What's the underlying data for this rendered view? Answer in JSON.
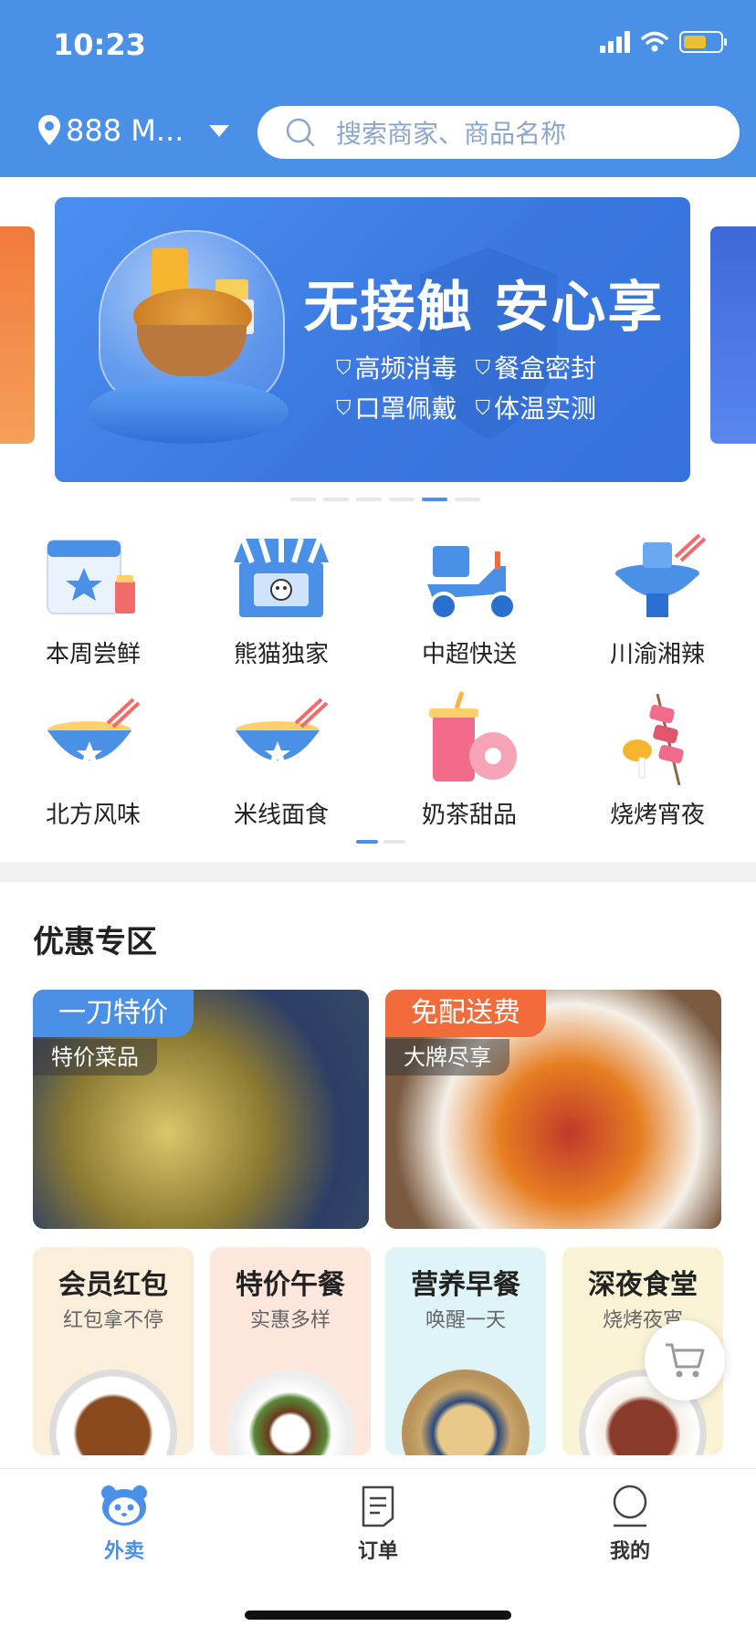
{
  "status": {
    "time": "10:23"
  },
  "header": {
    "location": "888 M...",
    "search_placeholder": "搜索商家、商品名称"
  },
  "banner": {
    "headline": "无接触 安心享",
    "tags": [
      "高频消毒",
      "餐盒密封",
      "口罩佩戴",
      "体温实测"
    ],
    "page_count": 6,
    "active_page": 5
  },
  "categories": [
    {
      "label": "本周尝鲜",
      "icon": "calendar-star-icon"
    },
    {
      "label": "熊猫独家",
      "icon": "panda-shop-icon"
    },
    {
      "label": "中超快送",
      "icon": "scooter-icon"
    },
    {
      "label": "川渝湘辣",
      "icon": "hotpot-icon"
    },
    {
      "label": "北方风味",
      "icon": "noodle-bowl-icon"
    },
    {
      "label": "米线面食",
      "icon": "noodle-bowl-icon"
    },
    {
      "label": "奶茶甜品",
      "icon": "milk-tea-donut-icon"
    },
    {
      "label": "烧烤宵夜",
      "icon": "bbq-skewer-icon"
    }
  ],
  "promo_section": {
    "title": "优惠专区",
    "featured": [
      {
        "tag": "一刀特价",
        "sub": "特价菜品",
        "tag_color": "#4a90e7"
      },
      {
        "tag": "免配送费",
        "sub": "大牌尽享",
        "tag_color": "#f26b3a"
      }
    ],
    "minis": [
      {
        "title": "会员红包",
        "subtitle": "红包拿不停",
        "bg": "#fbefdb"
      },
      {
        "title": "特价午餐",
        "subtitle": "实惠多样",
        "bg": "#fde6dc"
      },
      {
        "title": "营养早餐",
        "subtitle": "唤醒一天",
        "bg": "#def4f6"
      },
      {
        "title": "深夜食堂",
        "subtitle": "烧烤夜宵",
        "bg": "#fbf3d5"
      }
    ]
  },
  "tabbar": {
    "items": [
      {
        "label": "外卖",
        "icon": "panda-icon",
        "active": true
      },
      {
        "label": "订单",
        "icon": "order-document-icon",
        "active": false
      },
      {
        "label": "我的",
        "icon": "profile-icon",
        "active": false
      }
    ],
    "accent": "#4a90e7"
  }
}
